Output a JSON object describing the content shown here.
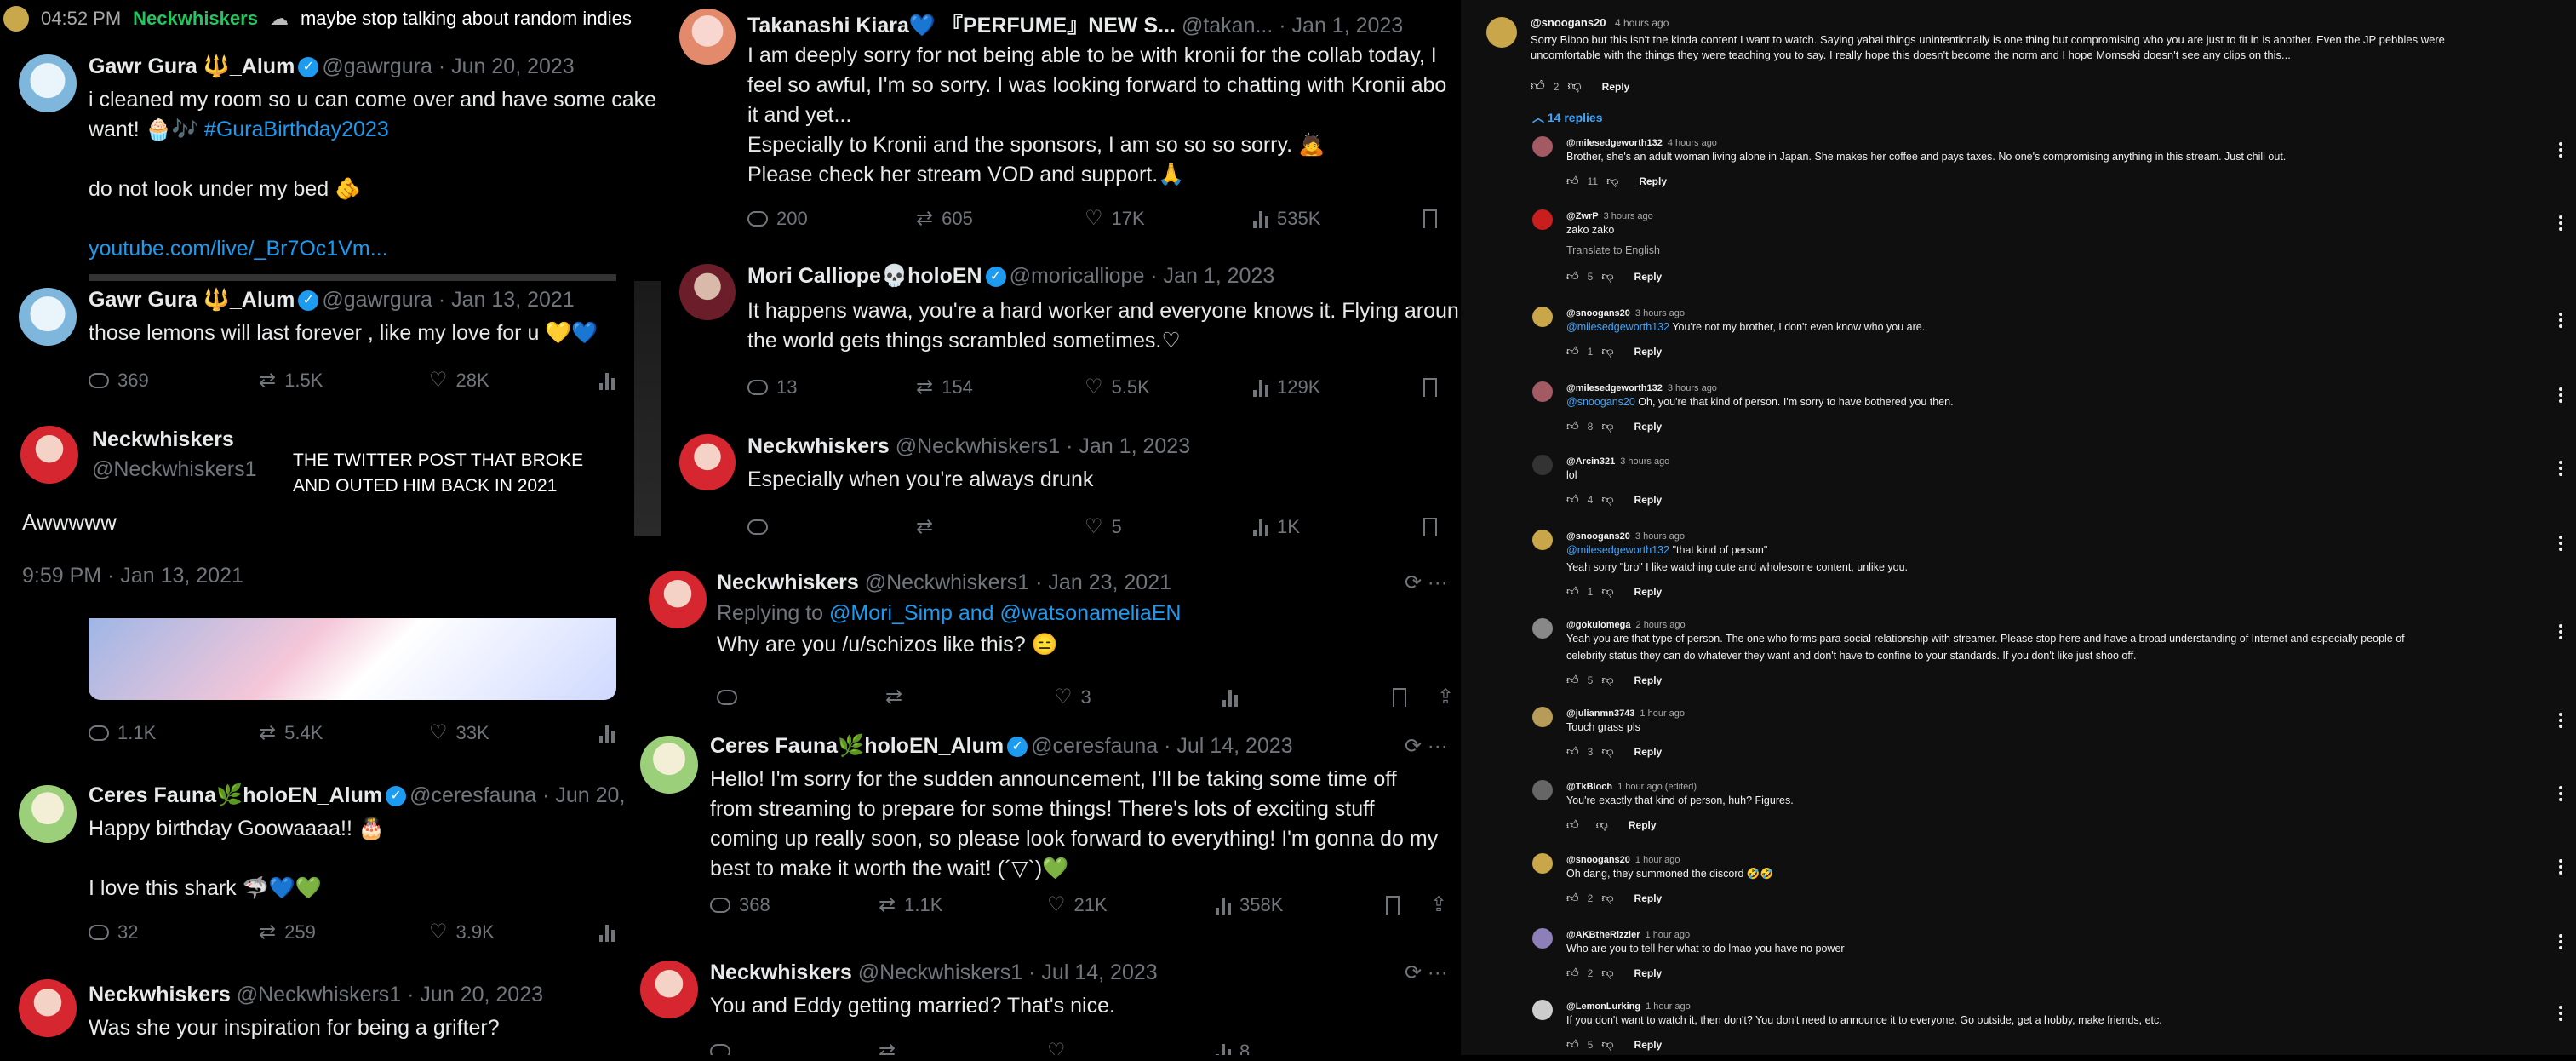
{
  "header": {
    "time": "04:52 PM",
    "channel": "Neckwhiskers",
    "message": "maybe stop talking about random indies"
  },
  "left": {
    "gura1": {
      "name": "Gawr Gura 🔱_Alum",
      "meta": "@gawrgura · Jun 20, 2023",
      "line1": "i cleaned my room so u can come over and have some cake",
      "line2": "want! 🧁🎶",
      "tag": "#GuraBirthday2023",
      "line3": "do not look under my bed 🫵",
      "link": "youtube.com/live/_Br7Oc1Vm..."
    },
    "gura2": {
      "name": "Gawr Gura 🔱_Alum",
      "meta": "@gawrgura · Jan 13, 2021",
      "text": "those lemons will last forever , like my love for u 💛💙",
      "replies": "369",
      "retweets": "1.5K",
      "likes": "28K"
    },
    "neck1": {
      "name": "Neckwhiskers",
      "handle": "@Neckwhiskers1",
      "note": "THE TWITTER POST THAT BROKE AND OUTED HIM BACK IN 2021",
      "text": "Awwwww",
      "time": "9:59 PM · Jan 13, 2021"
    },
    "gura_stats": {
      "replies": "1.1K",
      "retweets": "5.4K",
      "likes": "33K"
    },
    "ceres1": {
      "name": "Ceres Fauna🌿holoEN_Alum",
      "meta": "@ceresfauna · Jun 20,",
      "line1": "Happy birthday Goowaaaa!! 🎂",
      "line2": "I love this shark 🦈💙💚",
      "replies": "32",
      "retweets": "259",
      "likes": "3.9K"
    },
    "neck2": {
      "name": "Neckwhiskers",
      "meta": "@Neckwhiskers1 · Jun 20, 2023",
      "text": "Was she your inspiration for being a grifter?"
    }
  },
  "middle": {
    "kiara": {
      "name": "Takanashi Kiara💙 『PERFUME』NEW S...",
      "meta": "@takan... · Jan 1, 2023",
      "line1": "I am deeply sorry for not being able to be with kronii for the collab today, I",
      "line2": "feel so awful, I'm so sorry. I was looking forward to chatting with Kronii abo",
      "line3": "it and yet...",
      "line4": "Especially to Kronii and the sponsors, I am so so so sorry. 🙇",
      "line5": "Please check her stream VOD and support.🙏",
      "replies": "200",
      "retweets": "605",
      "likes": "17K",
      "views": "535K"
    },
    "mori": {
      "name": "Mori Calliope💀holoEN",
      "meta": "@moricalliope · Jan 1, 2023",
      "line1": "It happens wawa, you're a hard worker and everyone knows it. Flying aroun",
      "line2": "the world gets things scrambled sometimes.♡",
      "replies": "13",
      "retweets": "154",
      "likes": "5.5K",
      "views": "129K"
    },
    "neck3": {
      "name": "Neckwhiskers",
      "meta": "@Neckwhiskers1 · Jan 1, 2023",
      "text": "Especially when you're always drunk",
      "likes": "5",
      "views": "1K"
    },
    "neck4": {
      "name": "Neckwhiskers",
      "meta": "@Neckwhiskers1 · Jan 23, 2021",
      "replying": "Replying to",
      "replying_to": "@Mori_Simp and @watsonameliaEN",
      "text": "Why are you /u/schizos like this? 😑",
      "likes": "3"
    },
    "ceres2": {
      "name": "Ceres Fauna🌿holoEN_Alum",
      "meta": "@ceresfauna · Jul 14, 2023",
      "line1": "Hello! I'm sorry for the sudden announcement, I'll be taking some time off",
      "line2": "from streaming to prepare for some things! There's lots of exciting stuff",
      "line3": "coming up really soon, so please look forward to everything! I'm gonna do my",
      "line4": "best to make it worth the wait! (´▽`)💚",
      "replies": "368",
      "retweets": "1.1K",
      "likes": "21K",
      "views": "358K"
    },
    "neck5": {
      "name": "Neckwhiskers",
      "meta": "@Neckwhiskers1 · Jul 14, 2023",
      "text": "You and Eddy getting married? That's nice.",
      "views": "8"
    }
  },
  "youtube": {
    "top": {
      "author": "@snoogans20",
      "time": "4 hours ago",
      "line1": "Sorry Biboo but this isn't the kinda content I want to watch. Saying yabai things unintentionally is one thing but compromising who you are just to fit in is another. Even the JP pebbles were",
      "line2": "uncomfortable with the things they were teaching you to say. I really hope this doesn't become the norm and I hope Momseki doesn't see any clips on this...",
      "likes": "2",
      "reply": "Reply",
      "replies_toggle": "14 replies"
    },
    "replies": [
      {
        "author": "@milesedgeworth132",
        "time": "4 hours ago",
        "mention": "",
        "body": "Brother, she's an adult woman living alone in Japan. She makes her coffee and pays taxes. No one's compromising anything in this stream. Just chill out.",
        "body2": "",
        "likes": "11",
        "translate": ""
      },
      {
        "author": "@ZwrP",
        "time": "3 hours ago",
        "mention": "",
        "body": "zako zako",
        "body2": "",
        "likes": "5",
        "translate": "Translate to English"
      },
      {
        "author": "@snoogans20",
        "time": "3 hours ago",
        "mention": "@milesedgeworth132",
        "body": "You're not my brother, I don't even know who you are.",
        "body2": "",
        "likes": "1",
        "translate": ""
      },
      {
        "author": "@milesedgeworth132",
        "time": "3 hours ago",
        "mention": "@snoogans20",
        "body": "Oh, you're that kind of person. I'm sorry to have bothered you then.",
        "body2": "",
        "likes": "8",
        "translate": ""
      },
      {
        "author": "@Arcin321",
        "time": "3 hours ago",
        "mention": "",
        "body": "lol",
        "body2": "",
        "likes": "4",
        "translate": ""
      },
      {
        "author": "@snoogans20",
        "time": "3 hours ago",
        "mention": "@milesedgeworth132",
        "body": "\"that kind of person\"",
        "body2": "Yeah sorry \"bro\" I like watching cute and wholesome content, unlike you.",
        "likes": "1",
        "translate": ""
      },
      {
        "author": "@gokulomega",
        "time": "2 hours ago",
        "mention": "",
        "body": "Yeah you are that type of person. The one who forms para social relationship with streamer. Please stop here and have a broad understanding of Internet and especially people of",
        "body2": "celebrity status they can do whatever they want and don't have to confine to your standards. If you don't like just shoo off.",
        "likes": "5",
        "translate": ""
      },
      {
        "author": "@julianmn3743",
        "time": "1 hour ago",
        "mention": "",
        "body": "Touch grass pls",
        "body2": "",
        "likes": "3",
        "translate": ""
      },
      {
        "author": "@TkBloch",
        "time": "1 hour ago (edited)",
        "mention": "",
        "body": "You're exactly that kind of person, huh? Figures.",
        "body2": "",
        "likes": "",
        "translate": ""
      },
      {
        "author": "@snoogans20",
        "time": "1 hour ago",
        "mention": "",
        "body": "Oh dang, they summoned the discord 🤣🤣",
        "body2": "",
        "likes": "2",
        "translate": ""
      },
      {
        "author": "@AKBtheRizzler",
        "time": "1 hour ago",
        "mention": "",
        "body": "Who are you to tell her what to do lmao you have no power",
        "body2": "",
        "likes": "2",
        "translate": ""
      },
      {
        "author": "@LemonLurking",
        "time": "1 hour ago",
        "mention": "",
        "body": "If you don't want to watch it, then don't? You don't need to announce it to everyone. Go outside, get a hobby, make friends, etc.",
        "body2": "",
        "likes": "5",
        "translate": ""
      }
    ],
    "reply_label": "Reply"
  },
  "colors": {
    "accent_blue": "#1d9bf0",
    "channel_green": "#22c55e",
    "yt_bg": "#0f0f0f",
    "yt_mention": "#3ea6ff"
  }
}
